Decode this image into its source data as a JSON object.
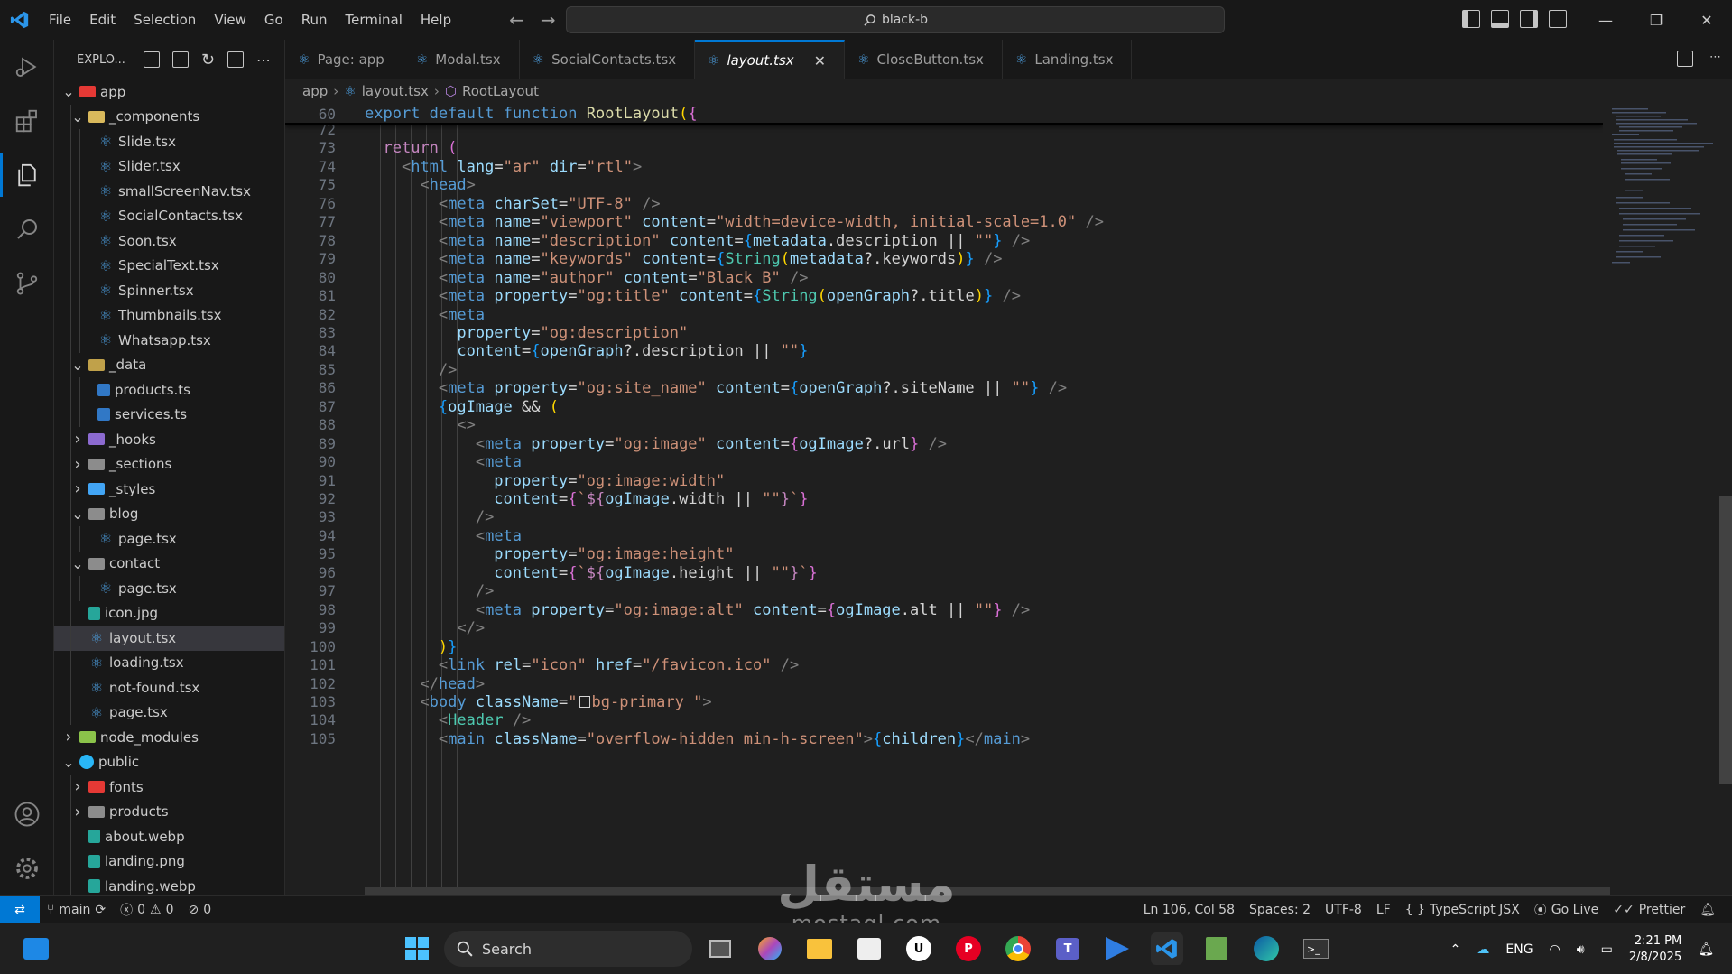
{
  "titlebar": {
    "menu": [
      "File",
      "Edit",
      "Selection",
      "View",
      "Go",
      "Run",
      "Terminal",
      "Help"
    ],
    "search": "black-b"
  },
  "sidebar": {
    "title": "EXPLO...",
    "tree": [
      {
        "label": "app",
        "depth": 0,
        "kind": "folder-app",
        "open": true
      },
      {
        "label": "_components",
        "depth": 1,
        "kind": "folder-comp",
        "open": true
      },
      {
        "label": "Slide.tsx",
        "depth": 2,
        "kind": "react"
      },
      {
        "label": "Slider.tsx",
        "depth": 2,
        "kind": "react"
      },
      {
        "label": "smallScreenNav.tsx",
        "depth": 2,
        "kind": "react"
      },
      {
        "label": "SocialContacts.tsx",
        "depth": 2,
        "kind": "react"
      },
      {
        "label": "Soon.tsx",
        "depth": 2,
        "kind": "react"
      },
      {
        "label": "SpecialText.tsx",
        "depth": 2,
        "kind": "react"
      },
      {
        "label": "Spinner.tsx",
        "depth": 2,
        "kind": "react"
      },
      {
        "label": "Thumbnails.tsx",
        "depth": 2,
        "kind": "react"
      },
      {
        "label": "Whatsapp.tsx",
        "depth": 2,
        "kind": "react"
      },
      {
        "label": "_data",
        "depth": 1,
        "kind": "folder-data",
        "open": true
      },
      {
        "label": "products.ts",
        "depth": 2,
        "kind": "ts"
      },
      {
        "label": "services.ts",
        "depth": 2,
        "kind": "ts"
      },
      {
        "label": "_hooks",
        "depth": 1,
        "kind": "folder-hooks",
        "open": false
      },
      {
        "label": "_sections",
        "depth": 1,
        "kind": "folder",
        "open": false
      },
      {
        "label": "_styles",
        "depth": 1,
        "kind": "folder-styles",
        "open": false
      },
      {
        "label": "blog",
        "depth": 1,
        "kind": "folder",
        "open": true
      },
      {
        "label": "page.tsx",
        "depth": 2,
        "kind": "react"
      },
      {
        "label": "contact",
        "depth": 1,
        "kind": "folder",
        "open": true
      },
      {
        "label": "page.tsx",
        "depth": 2,
        "kind": "react"
      },
      {
        "label": "icon.jpg",
        "depth": 1,
        "kind": "img"
      },
      {
        "label": "layout.tsx",
        "depth": 1,
        "kind": "react",
        "selected": true
      },
      {
        "label": "loading.tsx",
        "depth": 1,
        "kind": "react"
      },
      {
        "label": "not-found.tsx",
        "depth": 1,
        "kind": "react"
      },
      {
        "label": "page.tsx",
        "depth": 1,
        "kind": "react"
      },
      {
        "label": "node_modules",
        "depth": 0,
        "kind": "folder-nm",
        "open": false
      },
      {
        "label": "public",
        "depth": 0,
        "kind": "folder-pub",
        "open": true
      },
      {
        "label": "fonts",
        "depth": 1,
        "kind": "folder-fonts",
        "open": false
      },
      {
        "label": "products",
        "depth": 1,
        "kind": "folder",
        "open": false
      },
      {
        "label": "about.webp",
        "depth": 1,
        "kind": "img"
      },
      {
        "label": "landing.png",
        "depth": 1,
        "kind": "img"
      },
      {
        "label": "landing.webp",
        "depth": 1,
        "kind": "img"
      }
    ]
  },
  "tabs": [
    {
      "label": "Page: app",
      "active": false
    },
    {
      "label": "Modal.tsx",
      "active": false
    },
    {
      "label": "SocialContacts.tsx",
      "active": false
    },
    {
      "label": "layout.tsx",
      "active": true
    },
    {
      "label": "CloseButton.tsx",
      "active": false
    },
    {
      "label": "Landing.tsx",
      "active": false
    }
  ],
  "breadcrumb": [
    "app",
    "layout.tsx",
    "RootLayout"
  ],
  "editor": {
    "sticky_line": {
      "num": "60",
      "html": "<span class='k'>export</span> <span class='k'>default</span> <span class='k'>function</span> <span class='f'>RootLayout</span><span class='b1'>(</span><span class='b2'>{</span>"
    },
    "lines": [
      {
        "num": "72",
        "html": ""
      },
      {
        "num": "73",
        "html": "  <span class='kc'>return</span> <span class='b2'>(</span>"
      },
      {
        "num": "74",
        "html": "    <span class='p'>&lt;</span><span class='t'>html</span> <span class='a'>lang</span><span class='w'>=</span><span class='s'>\"ar\"</span> <span class='a'>dir</span><span class='w'>=</span><span class='s'>\"rtl\"</span><span class='p'>&gt;</span>"
      },
      {
        "num": "75",
        "html": "      <span class='p'>&lt;</span><span class='t'>head</span><span class='p'>&gt;</span>"
      },
      {
        "num": "76",
        "html": "        <span class='p'>&lt;</span><span class='t'>meta</span> <span class='a'>charSet</span><span class='w'>=</span><span class='s'>\"UTF-8\"</span> <span class='p'>/&gt;</span>"
      },
      {
        "num": "77",
        "html": "        <span class='p'>&lt;</span><span class='t'>meta</span> <span class='a'>name</span><span class='w'>=</span><span class='s'>\"viewport\"</span> <span class='a'>content</span><span class='w'>=</span><span class='s'>\"width=device-width, initial-scale=1.0\"</span> <span class='p'>/&gt;</span>"
      },
      {
        "num": "78",
        "html": "        <span class='p'>&lt;</span><span class='t'>meta</span> <span class='a'>name</span><span class='w'>=</span><span class='s'>\"description\"</span> <span class='a'>content</span><span class='w'>=</span><span class='b3'>{</span><span class='v'>metadata</span><span class='w'>.description</span> <span class='w'>||</span> <span class='s'>\"\"</span><span class='b3'>}</span> <span class='p'>/&gt;</span>"
      },
      {
        "num": "79",
        "html": "        <span class='p'>&lt;</span><span class='t'>meta</span> <span class='a'>name</span><span class='w'>=</span><span class='s'>\"keywords\"</span> <span class='a'>content</span><span class='w'>=</span><span class='b3'>{</span><span class='c'>String</span><span class='b1'>(</span><span class='v'>metadata</span><span class='w'>?.keywords</span><span class='b1'>)</span><span class='b3'>}</span> <span class='p'>/&gt;</span>"
      },
      {
        "num": "80",
        "html": "        <span class='p'>&lt;</span><span class='t'>meta</span> <span class='a'>name</span><span class='w'>=</span><span class='s'>\"author\"</span> <span class='a'>content</span><span class='w'>=</span><span class='s'>\"Black B\"</span> <span class='p'>/&gt;</span>"
      },
      {
        "num": "81",
        "html": "        <span class='p'>&lt;</span><span class='t'>meta</span> <span class='a'>property</span><span class='w'>=</span><span class='s'>\"og:title\"</span> <span class='a'>content</span><span class='w'>=</span><span class='b3'>{</span><span class='c'>String</span><span class='b1'>(</span><span class='v'>openGraph</span><span class='w'>?.title</span><span class='b1'>)</span><span class='b3'>}</span> <span class='p'>/&gt;</span>"
      },
      {
        "num": "82",
        "html": "        <span class='p'>&lt;</span><span class='t'>meta</span>"
      },
      {
        "num": "83",
        "html": "          <span class='a'>property</span><span class='w'>=</span><span class='s'>\"og:description\"</span>"
      },
      {
        "num": "84",
        "html": "          <span class='a'>content</span><span class='w'>=</span><span class='b3'>{</span><span class='v'>openGraph</span><span class='w'>?.description</span> <span class='w'>||</span> <span class='s'>\"\"</span><span class='b3'>}</span>"
      },
      {
        "num": "85",
        "html": "        <span class='p'>/&gt;</span>"
      },
      {
        "num": "86",
        "html": "        <span class='p'>&lt;</span><span class='t'>meta</span> <span class='a'>property</span><span class='w'>=</span><span class='s'>\"og:site_name\"</span> <span class='a'>content</span><span class='w'>=</span><span class='b3'>{</span><span class='v'>openGraph</span><span class='w'>?.siteName</span> <span class='w'>||</span> <span class='s'>\"\"</span><span class='b3'>}</span> <span class='p'>/&gt;</span>"
      },
      {
        "num": "87",
        "html": "        <span class='b3'>{</span><span class='v'>ogImage</span> <span class='w'>&amp;&amp;</span> <span class='b1'>(</span>"
      },
      {
        "num": "88",
        "html": "          <span class='p'>&lt;&gt;</span>"
      },
      {
        "num": "89",
        "html": "            <span class='p'>&lt;</span><span class='t'>meta</span> <span class='a'>property</span><span class='w'>=</span><span class='s'>\"og:image\"</span> <span class='a'>content</span><span class='w'>=</span><span class='b2'>{</span><span class='v'>ogImage</span><span class='w'>?.url</span><span class='b2'>}</span> <span class='p'>/&gt;</span>"
      },
      {
        "num": "90",
        "html": "            <span class='p'>&lt;</span><span class='t'>meta</span>"
      },
      {
        "num": "91",
        "html": "              <span class='a'>property</span><span class='w'>=</span><span class='s'>\"og:image:width\"</span>"
      },
      {
        "num": "92",
        "html": "              <span class='a'>content</span><span class='w'>=</span><span class='b2'>{</span><span class='s'>`</span><span class='kc'>${</span><span class='v'>ogImage</span><span class='w'>.width</span> <span class='w'>||</span> <span class='s'>\"\"</span><span class='kc'>}</span><span class='s'>`</span><span class='b2'>}</span>"
      },
      {
        "num": "93",
        "html": "            <span class='p'>/&gt;</span>"
      },
      {
        "num": "94",
        "html": "            <span class='p'>&lt;</span><span class='t'>meta</span>"
      },
      {
        "num": "95",
        "html": "              <span class='a'>property</span><span class='w'>=</span><span class='s'>\"og:image:height\"</span>"
      },
      {
        "num": "96",
        "html": "              <span class='a'>content</span><span class='w'>=</span><span class='b2'>{</span><span class='s'>`</span><span class='kc'>${</span><span class='v'>ogImage</span><span class='w'>.height</span> <span class='w'>||</span> <span class='s'>\"\"</span><span class='kc'>}</span><span class='s'>`</span><span class='b2'>}</span>"
      },
      {
        "num": "97",
        "html": "            <span class='p'>/&gt;</span>"
      },
      {
        "num": "98",
        "html": "            <span class='p'>&lt;</span><span class='t'>meta</span> <span class='a'>property</span><span class='w'>=</span><span class='s'>\"og:image:alt\"</span> <span class='a'>content</span><span class='w'>=</span><span class='b2'>{</span><span class='v'>ogImage</span><span class='w'>.alt</span> <span class='w'>||</span> <span class='s'>\"\"</span><span class='b2'>}</span> <span class='p'>/&gt;</span>"
      },
      {
        "num": "99",
        "html": "          <span class='p'>&lt;/&gt;</span>"
      },
      {
        "num": "100",
        "html": "        <span class='b1'>)</span><span class='b3'>}</span>"
      },
      {
        "num": "101",
        "html": "        <span class='p'>&lt;</span><span class='t'>link</span> <span class='a'>rel</span><span class='w'>=</span><span class='s'>\"icon\"</span> <span class='a'>href</span><span class='w'>=</span><span class='s'>\"/favicon.ico\"</span> <span class='p'>/&gt;</span>"
      },
      {
        "num": "102",
        "html": "      <span class='p'>&lt;/</span><span class='t'>head</span><span class='p'>&gt;</span>"
      },
      {
        "num": "103",
        "html": "      <span class='p'>&lt;</span><span class='t'>body</span> <span class='a'>className</span><span class='w'>=</span><span class='s'>\"<span style='display:inline-block;width:12px;height:13px;border:1px solid #d4d4d4;vertical-align:-1px;margin:0 2px'></span>bg-primary \"</span><span class='p'>&gt;</span>"
      },
      {
        "num": "104",
        "html": "        <span class='p'>&lt;</span><span class='c'>Header</span> <span class='p'>/&gt;</span>"
      },
      {
        "num": "105",
        "html": "        <span class='p'>&lt;</span><span class='t'>main</span> <span class='a'>className</span><span class='w'>=</span><span class='s'>\"overflow-hidden min-h-screen\"</span><span class='p'>&gt;</span><span class='b3'>{</span><span class='v'>children</span><span class='b3'>}</span><span class='p'>&lt;/</span><span class='t'>main</span><span class='p'>&gt;</span>"
      }
    ]
  },
  "statusbar": {
    "branch": "main",
    "errors": "0",
    "warnings": "0",
    "ports": "0",
    "position": "Ln 106, Col 58",
    "spaces": "Spaces: 2",
    "encoding": "UTF-8",
    "eol": "LF",
    "language": "TypeScript JSX",
    "golive": "Go Live",
    "prettier": "Prettier"
  },
  "taskbar": {
    "search": "Search",
    "lang": "ENG",
    "time": "2:21 PM",
    "date": "2/8/2025"
  },
  "watermark": {
    "arabic": "مستقل",
    "latin": "mostaql.com"
  },
  "colors": {
    "accent": "#0078d4",
    "editor_bg": "#1f1f1f",
    "chrome_bg": "#181818"
  }
}
